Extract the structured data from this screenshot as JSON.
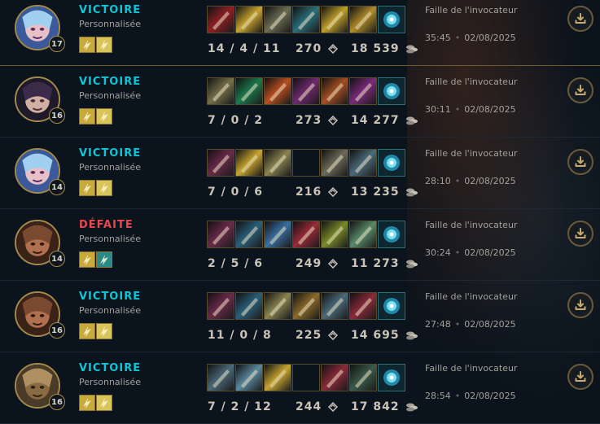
{
  "matches": [
    {
      "result": "VICTOIRE",
      "type": "win",
      "mode": "Personnalisée",
      "level": "17",
      "champion": "jinx",
      "kda": "14 / 4 / 11",
      "cs": "270",
      "gold": "18 539",
      "map": "Faille de l'invocateur",
      "duration": "35:45",
      "date": "02/08/2025",
      "spells": [
        "#c8a93b",
        "#d9c45a"
      ],
      "items": [
        "#8f1f25",
        "#c7a531",
        "#6b6c54",
        "#2a6f7c",
        "#c0a12a",
        "#b08c2a",
        "trinket"
      ]
    },
    {
      "result": "VICTOIRE",
      "type": "win",
      "mode": "Personnalisée",
      "level": "16",
      "champion": "vayne",
      "kda": "7 / 0 / 2",
      "cs": "273",
      "gold": "14 277",
      "map": "Faille de l'invocateur",
      "duration": "30:11",
      "date": "02/08/2025",
      "spells": [
        "#c8a93b",
        "#d9c45a"
      ],
      "items": [
        "#75704a",
        "#1d7a4d",
        "#b84f20",
        "#6e2a6e",
        "#a44f23",
        "#7a2a7a",
        "trinket"
      ]
    },
    {
      "result": "VICTOIRE",
      "type": "win",
      "mode": "Personnalisée",
      "level": "14",
      "champion": "jinx",
      "kda": "7 / 0 / 6",
      "cs": "216",
      "gold": "13 235",
      "map": "Faille de l'invocateur",
      "duration": "28:10",
      "date": "02/08/2025",
      "spells": [
        "#c8a93b",
        "#d9c45a"
      ],
      "items": [
        "#6a2a4a",
        "#c7a531",
        "#8a8450",
        "empty",
        "#6d6a58",
        "#4a6a7a",
        "trinket"
      ]
    },
    {
      "result": "DÉFAITE",
      "type": "loss",
      "mode": "Personnalisée",
      "level": "14",
      "champion": "lucian",
      "kda": "2 / 5 / 6",
      "cs": "249",
      "gold": "11 273",
      "map": "Faille de l'invocateur",
      "duration": "30:24",
      "date": "02/08/2025",
      "spells": [
        "#c8a93b",
        "#2a8a8a"
      ],
      "items": [
        "#6a2a4a",
        "#2a5f7a",
        "#3a6fa0",
        "#9a2a3a",
        "#7a8a2a",
        "#5a8a6a",
        "trinket"
      ]
    },
    {
      "result": "VICTOIRE",
      "type": "win",
      "mode": "Personnalisée",
      "level": "16",
      "champion": "lucian",
      "kda": "11 / 0 / 8",
      "cs": "225",
      "gold": "14 695",
      "map": "Faille de l'invocateur",
      "duration": "27:48",
      "date": "02/08/2025",
      "spells": [
        "#c8a93b",
        "#d9c45a"
      ],
      "items": [
        "#6a2a4a",
        "#2a5f7a",
        "#8a8450",
        "#8a6a2a",
        "#4a6a7a",
        "#8a2a3a",
        "trinket"
      ]
    },
    {
      "result": "VICTOIRE",
      "type": "win",
      "mode": "Personnalisée",
      "level": "16",
      "champion": "corki",
      "kda": "7 / 2 / 12",
      "cs": "244",
      "gold": "17 842",
      "map": "Faille de l'invocateur",
      "duration": "28:54",
      "date": "02/08/2025",
      "spells": [
        "#c8a93b",
        "#d9c45a"
      ],
      "items": [
        "#4a6a7a",
        "#5a8aa0",
        "#c7a531",
        "empty",
        "#8a2a3a",
        "#3a5a4a",
        "trinket"
      ]
    }
  ],
  "icons": {
    "gold": "coin-stack-icon",
    "cs": "minion-icon",
    "download": "download-icon"
  }
}
